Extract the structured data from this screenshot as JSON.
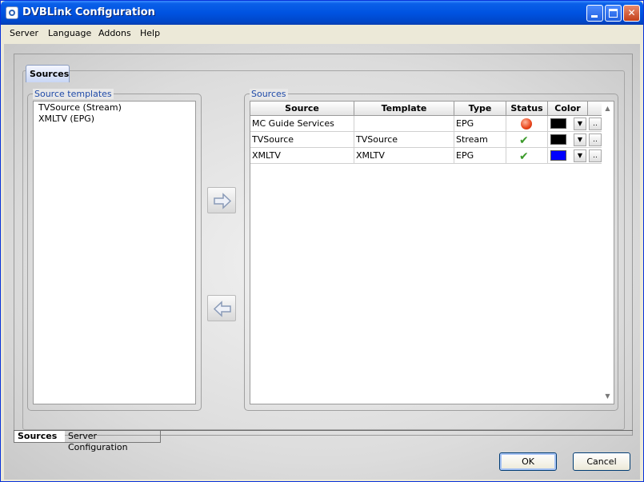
{
  "window": {
    "title": "DVBLink Configuration"
  },
  "menu": [
    "Server",
    "Language",
    "Addons",
    "Help"
  ],
  "top_tab": "Sources",
  "templates": {
    "title": "Source templates",
    "items": [
      "TVSource (Stream)",
      "XMLTV (EPG)"
    ]
  },
  "sources": {
    "title": "Sources",
    "columns": [
      "Source",
      "Template",
      "Type",
      "Status",
      "Color"
    ],
    "rows": [
      {
        "source": "MC Guide Services",
        "template": "",
        "type": "EPG",
        "status": "error",
        "color": "#000000"
      },
      {
        "source": "TVSource",
        "template": "TVSource",
        "type": "Stream",
        "status": "ok",
        "color": "#000000"
      },
      {
        "source": "XMLTV",
        "template": "XMLTV",
        "type": "EPG",
        "status": "ok",
        "color": "#0000FF"
      }
    ],
    "dots_label": ".."
  },
  "bottom_tabs": [
    "Sources",
    "Server Configuration"
  ],
  "buttons": {
    "ok": "OK",
    "cancel": "Cancel"
  }
}
